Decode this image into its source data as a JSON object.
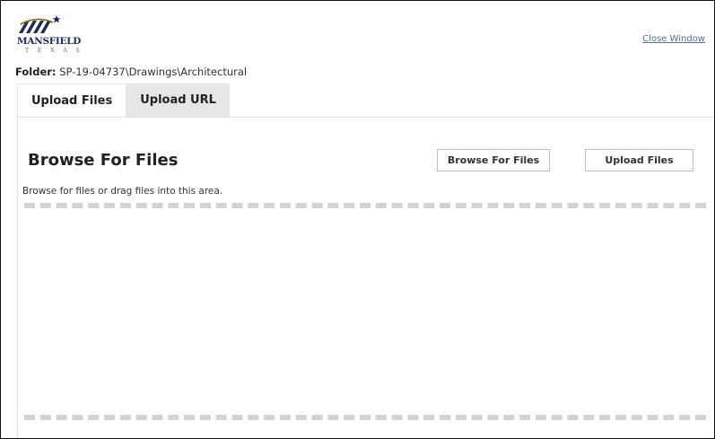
{
  "logo": {
    "name": "MANSFIELD",
    "subtitle": "T E X A S"
  },
  "header": {
    "close_label": "Close Window"
  },
  "folder": {
    "label": "Folder:",
    "path": " SP-19-04737\\Drawings\\Architectural"
  },
  "tabs": [
    {
      "label": "Upload Files",
      "active": true
    },
    {
      "label": "Upload URL",
      "active": false
    }
  ],
  "panel": {
    "title": "Browse For Files",
    "browse_button": "Browse For Files",
    "upload_button": "Upload Files",
    "hint": "Browse for files or drag files into this area."
  },
  "colors": {
    "brand_navy": "#1d2a55",
    "brand_gold": "#8a6a1a",
    "link": "#5a6e91",
    "tab_inactive": "#e6e6e6",
    "dashed_border": "#d3d3d3"
  }
}
